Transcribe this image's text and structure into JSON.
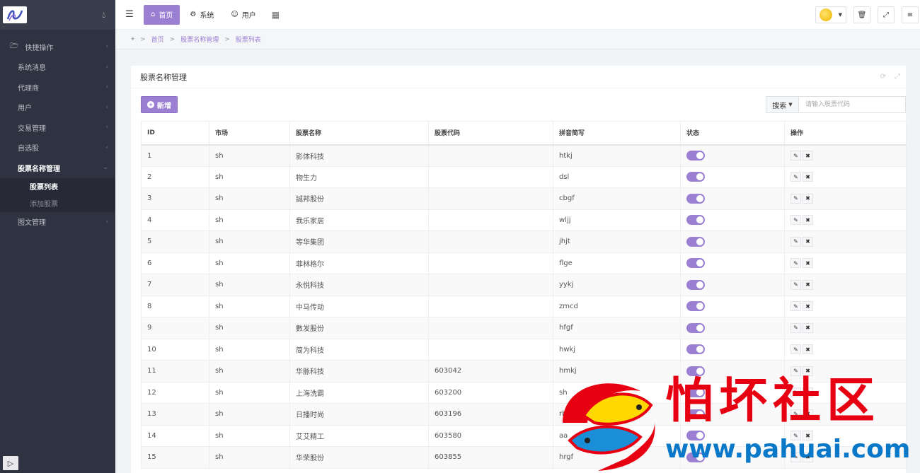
{
  "sidebar": {
    "items": [
      {
        "label": "快捷操作",
        "icon": "folder-icon"
      },
      {
        "label": "系统消息"
      },
      {
        "label": "代理商"
      },
      {
        "label": "用户"
      },
      {
        "label": "交易管理"
      },
      {
        "label": "自选股"
      },
      {
        "label": "股票名称管理",
        "active": true
      },
      {
        "label": "图文管理"
      }
    ],
    "submenu": [
      {
        "label": "股票列表",
        "current": true
      },
      {
        "label": "添加股票"
      }
    ]
  },
  "topbar": {
    "tabs": [
      {
        "label": "首页",
        "icon": "home-icon",
        "active": true
      },
      {
        "label": "系统",
        "icon": "gear-icon"
      },
      {
        "label": "用户",
        "icon": "user-icon"
      }
    ]
  },
  "breadcrumb": [
    "首页",
    "股票名称管理",
    "股票列表"
  ],
  "panel": {
    "title": "股票名称管理",
    "add_label": "新增",
    "search_label": "搜索",
    "search_placeholder": "请输入股票代码"
  },
  "table": {
    "columns": [
      "ID",
      "市场",
      "股票名称",
      "股票代码",
      "拼音简写",
      "状态",
      "操作"
    ],
    "rows": [
      {
        "id": "1",
        "market": "sh",
        "name": "影体科技",
        "code": "",
        "pinyin": "htkj"
      },
      {
        "id": "2",
        "market": "sh",
        "name": "物生力",
        "code": "",
        "pinyin": "dsl"
      },
      {
        "id": "3",
        "market": "sh",
        "name": "誠邦股份",
        "code": "",
        "pinyin": "cbgf"
      },
      {
        "id": "4",
        "market": "sh",
        "name": "我乐家居",
        "code": "",
        "pinyin": "wljj"
      },
      {
        "id": "5",
        "market": "sh",
        "name": "等华集团",
        "code": "",
        "pinyin": "jhjt"
      },
      {
        "id": "6",
        "market": "sh",
        "name": "菲林格尔",
        "code": "",
        "pinyin": "flge"
      },
      {
        "id": "7",
        "market": "sh",
        "name": "永悦科技",
        "code": "",
        "pinyin": "yykj"
      },
      {
        "id": "8",
        "market": "sh",
        "name": "中马传动",
        "code": "",
        "pinyin": "zmcd"
      },
      {
        "id": "9",
        "market": "sh",
        "name": "數发股份",
        "code": "",
        "pinyin": "hfgf"
      },
      {
        "id": "10",
        "market": "sh",
        "name": "简为科技",
        "code": "",
        "pinyin": "hwkj"
      },
      {
        "id": "11",
        "market": "sh",
        "name": "华脉科技",
        "code": "603042",
        "pinyin": "hmkj"
      },
      {
        "id": "12",
        "market": "sh",
        "name": "上海洗霸",
        "code": "603200",
        "pinyin": "sh"
      },
      {
        "id": "13",
        "market": "sh",
        "name": "日播时尚",
        "code": "603196",
        "pinyin": "rb"
      },
      {
        "id": "14",
        "market": "sh",
        "name": "艾艾精工",
        "code": "603580",
        "pinyin": "aa"
      },
      {
        "id": "15",
        "market": "sh",
        "name": "华荣股份",
        "code": "603855",
        "pinyin": "hrgf"
      }
    ]
  },
  "watermark": {
    "text": "怕坏社区",
    "url": "www.pahuai.com"
  }
}
